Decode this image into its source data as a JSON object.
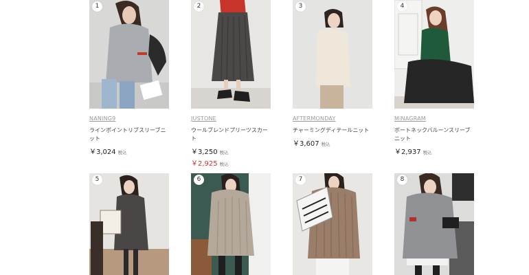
{
  "products": [
    {
      "rank": "1",
      "brand": "NANING9",
      "name": "ラインポイントリブスリーブニット",
      "price": "￥3,024",
      "tax_label": "税込"
    },
    {
      "rank": "2",
      "brand": "JUSTONE",
      "name": "ウールブレンドプリーツスカート",
      "price": "￥3,250",
      "tax_label": "税込",
      "sale_price": "￥2,925",
      "sale_tax_label": "税込"
    },
    {
      "rank": "3",
      "brand": "AFTERMONDAY",
      "name": "チャーミングディテールニット",
      "price": "￥3,607",
      "tax_label": "税込"
    },
    {
      "rank": "4",
      "brand": "MiNAGRAM",
      "name": "ボートネックバルーンスリーブニット",
      "price": "￥2,937",
      "tax_label": "税込"
    },
    {
      "rank": "5"
    },
    {
      "rank": "6"
    },
    {
      "rank": "7"
    },
    {
      "rank": "8"
    }
  ]
}
